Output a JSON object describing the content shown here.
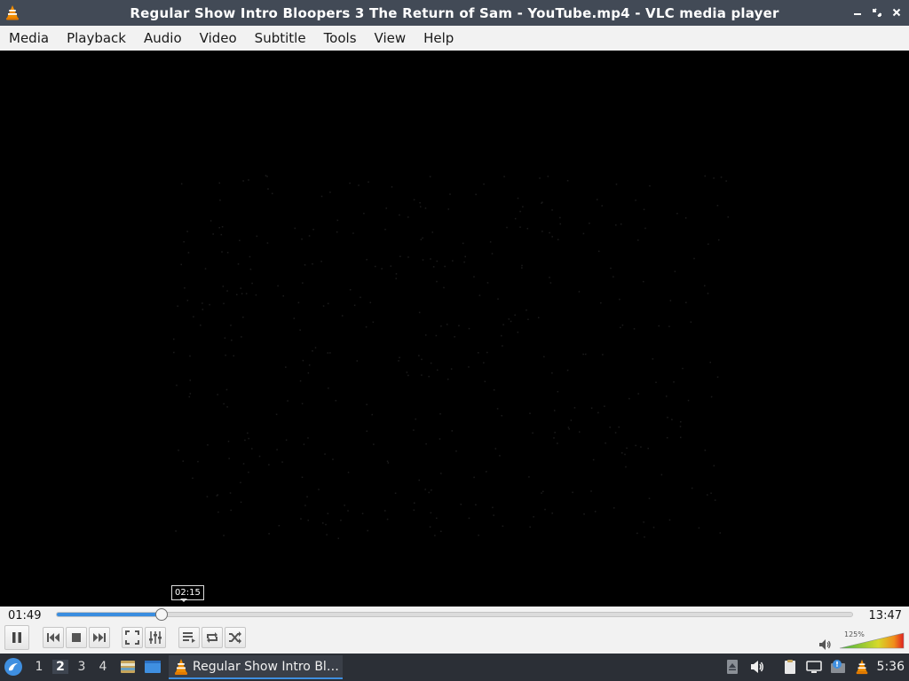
{
  "window": {
    "title": "Regular Show Intro Bloopers 3 The Return of Sam - YouTube.mp4 - VLC media player"
  },
  "menu": [
    "Media",
    "Playback",
    "Audio",
    "Video",
    "Subtitle",
    "Tools",
    "View",
    "Help"
  ],
  "player": {
    "elapsed": "01:49",
    "total": "13:47",
    "hover_time": "02:15",
    "progress": 0.132,
    "volume_label": "125%",
    "volume_level": 1.0
  },
  "taskbar": {
    "desktops": [
      "1",
      "2",
      "3",
      "4"
    ],
    "active_desktop": "2",
    "task_label": "Regular Show Intro Bl…",
    "clock": "5:36"
  },
  "colors": {
    "accent": "#3a8ddf",
    "titlebar": "#424a56",
    "taskbar": "#2b2f36",
    "vlc_orange": "#f08c00"
  }
}
